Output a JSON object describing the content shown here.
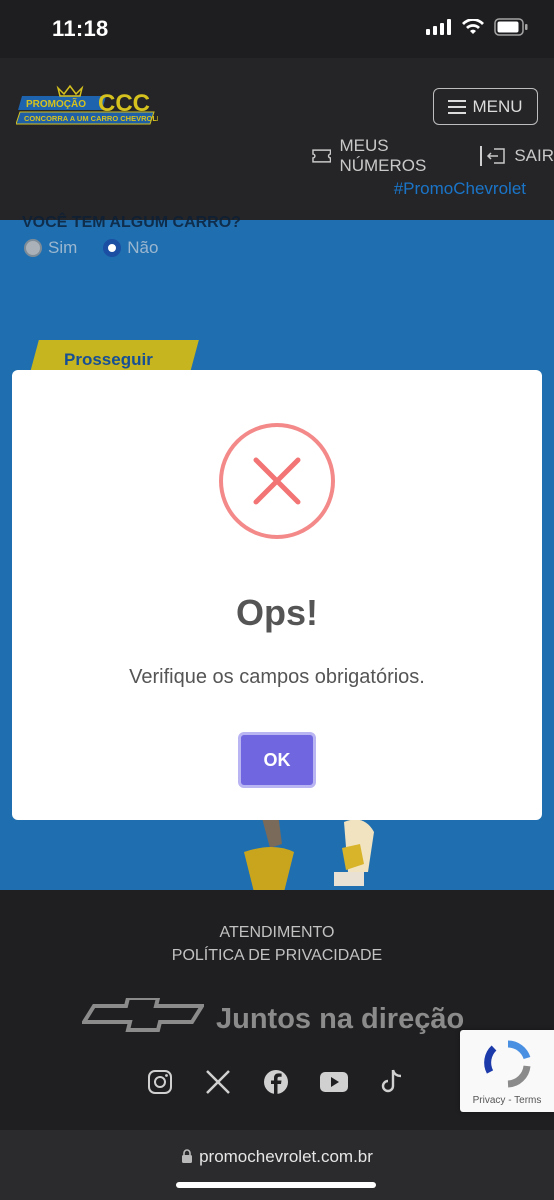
{
  "status_bar": {
    "time": "11:18"
  },
  "header": {
    "logo_top": "PROMOÇÃO",
    "logo_main": "CCC",
    "logo_sub": "CONCORRA A UM CARRO CHEVROLET",
    "menu_label": "MENU",
    "nav": [
      {
        "label": "MEUS NÚMEROS",
        "icon": "ticket-icon"
      },
      {
        "label": "SAIR",
        "icon": "logout-icon"
      }
    ],
    "hashtag": "#PromoChevrolet"
  },
  "form": {
    "question": "VOCÊ TEM ALGUM CARRO?",
    "options": [
      {
        "label": "Sim",
        "selected": false
      },
      {
        "label": "Não",
        "selected": true
      }
    ],
    "proceed_label": "Prosseguir"
  },
  "modal": {
    "title": "Ops!",
    "message": "Verifique os campos obrigatórios.",
    "ok_label": "OK",
    "icon": "error-x-icon",
    "icon_color": "#f27474",
    "button_color": "#7066e0"
  },
  "footer": {
    "links": [
      "ATENDIMENTO",
      "POLÍTICA DE PRIVACIDADE"
    ],
    "brand_text": "Juntos na direção",
    "social": [
      "instagram-icon",
      "x-icon",
      "facebook-icon",
      "youtube-icon",
      "tiktok-icon"
    ]
  },
  "recaptcha": {
    "text": "Privacy - Terms"
  },
  "browser": {
    "url": "promochevrolet.com.br"
  }
}
